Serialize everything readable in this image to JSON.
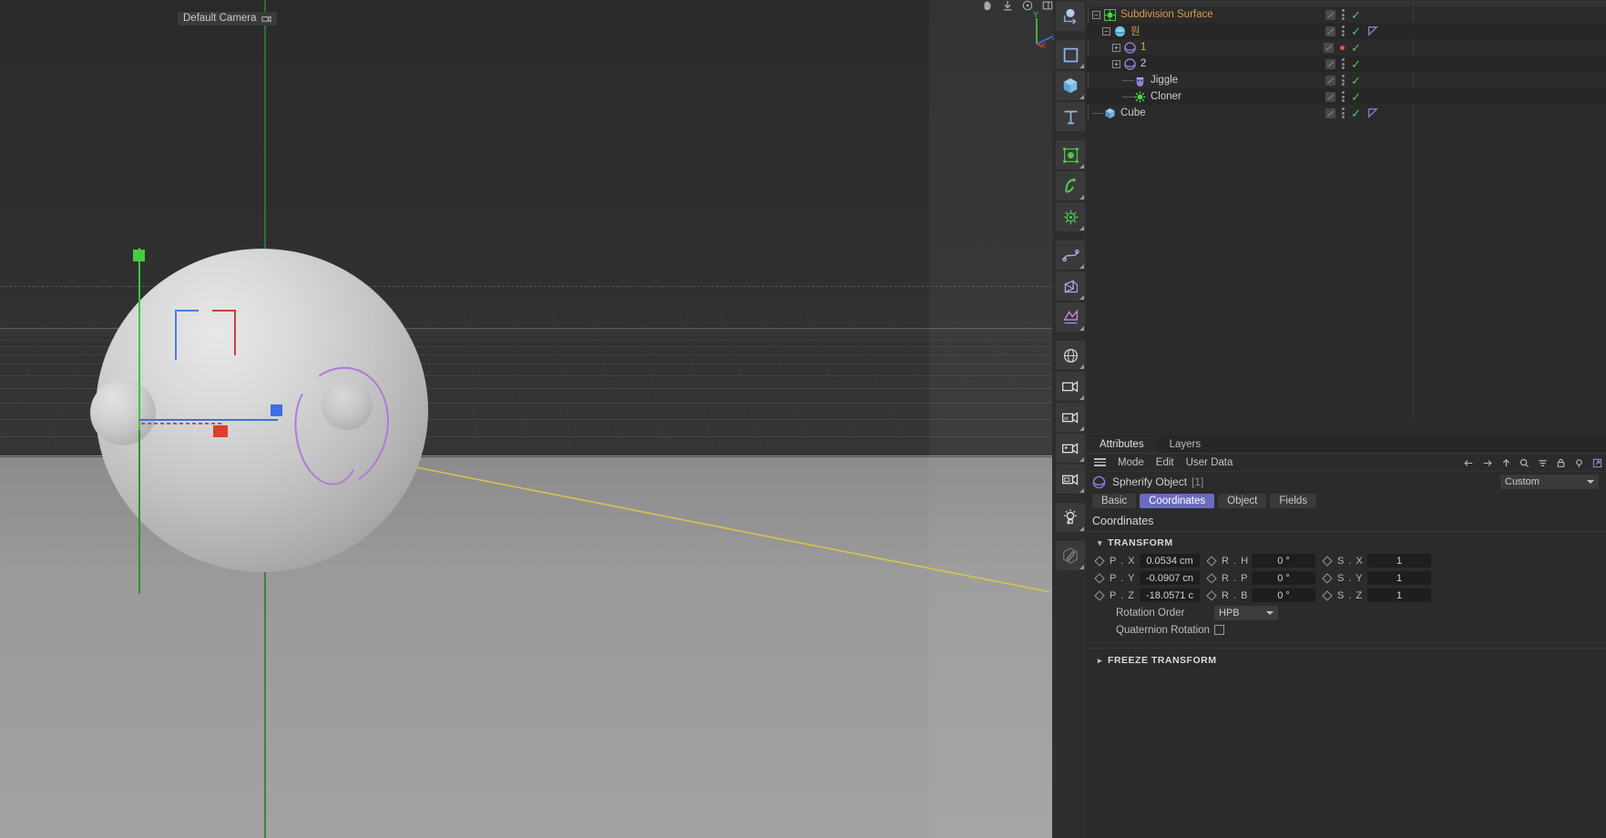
{
  "viewport": {
    "camera_label": "Default Camera",
    "camera_icon": "camera-lock-icon",
    "hud_axes": {
      "y": "Y",
      "x": "X",
      "z": "Z"
    }
  },
  "top_strip": {
    "icons": [
      "hand-icon",
      "move-down-icon",
      "target-icon",
      "frame-icon"
    ]
  },
  "toolbar": {
    "items": [
      {
        "name": "render-preview-icon",
        "glyph": "sphere-arrow"
      },
      {
        "name": "rectangle-select-icon",
        "glyph": "square"
      },
      {
        "name": "cube-primitive-icon",
        "glyph": "cube"
      },
      {
        "name": "text-tool-icon",
        "glyph": "T"
      },
      {
        "name": "spline-pen-icon",
        "glyph": "spline"
      },
      {
        "name": "mograph-icon",
        "glyph": "mograph"
      },
      {
        "name": "deformer-icon",
        "glyph": "deformer"
      },
      {
        "name": "scene-object-icon",
        "glyph": "scene"
      },
      {
        "name": "field-object-icon",
        "glyph": "field"
      },
      {
        "name": "mesh-tool-icon",
        "glyph": "mesh"
      },
      {
        "name": "environment-icon",
        "glyph": "globe"
      },
      {
        "name": "camera-icon",
        "glyph": "camera"
      },
      {
        "name": "stage-camera-icon",
        "glyph": "stage-camera"
      },
      {
        "name": "motion-camera-icon",
        "glyph": "motion-camera"
      },
      {
        "name": "tracker-camera-icon",
        "glyph": "tracker-camera"
      },
      {
        "name": "light-icon",
        "glyph": "light"
      },
      {
        "name": "sketch-material-icon",
        "glyph": "pencil-hex"
      }
    ]
  },
  "object_manager": {
    "rows": [
      {
        "name": "Subdivision Surface",
        "indent": 0,
        "expander": "minus",
        "icon": "subdivision-surface-icon",
        "color": "orange",
        "dot_state": "normal",
        "visible": true,
        "has_flag": false
      },
      {
        "name": "원",
        "indent": 1,
        "expander": "minus",
        "icon": "sphere-icon",
        "color": "orange",
        "dot_state": "normal",
        "visible": true,
        "has_flag": true
      },
      {
        "name": "1",
        "indent": 2,
        "expander": "plus",
        "icon": "spherify-icon",
        "color": "yellow",
        "dot_state": "red",
        "visible": true,
        "has_flag": false
      },
      {
        "name": "2",
        "indent": 2,
        "expander": "plus",
        "icon": "spherify-icon",
        "color": "white",
        "dot_state": "normal",
        "visible": true,
        "has_flag": false
      },
      {
        "name": "Jiggle",
        "indent": 3,
        "expander": "none",
        "icon": "jiggle-icon",
        "color": "white",
        "dot_state": "normal",
        "visible": true,
        "has_flag": false
      },
      {
        "name": "Cloner",
        "indent": 3,
        "expander": "none",
        "icon": "cloner-icon",
        "color": "white",
        "dot_state": "normal",
        "visible": true,
        "has_flag": false
      },
      {
        "name": "Cube",
        "indent": 0,
        "expander": "none",
        "icon": "cube-object-icon",
        "color": "white",
        "dot_state": "normal",
        "visible": true,
        "has_flag": true
      }
    ]
  },
  "attributes": {
    "tabs": [
      {
        "label": "Attributes",
        "active": true
      },
      {
        "label": "Layers",
        "active": false
      }
    ],
    "menu": [
      "Mode",
      "Edit",
      "User Data"
    ],
    "menu_icons": [
      "back-arrow-icon",
      "forward-arrow-icon",
      "up-arrow-icon",
      "search-icon",
      "filter-icon",
      "lock-icon",
      "pin-icon",
      "popout-icon"
    ],
    "object_title": "Spherify Object",
    "object_count": "[1]",
    "custom_select": "Custom",
    "sub_tabs": [
      {
        "label": "Basic",
        "active": false
      },
      {
        "label": "Coordinates",
        "active": true
      },
      {
        "label": "Object",
        "active": false
      },
      {
        "label": "Fields",
        "active": false
      }
    ],
    "section_title": "Coordinates",
    "transform_section": "TRANSFORM",
    "freeze_section": "FREEZE TRANSFORM",
    "transform": {
      "position": [
        {
          "label": "P . X",
          "value": "0.0534 cm"
        },
        {
          "label": "P . Y",
          "value": "-0.0907 cn"
        },
        {
          "label": "P . Z",
          "value": "-18.0571 c"
        }
      ],
      "rotation": [
        {
          "label": "R . H",
          "value": "0 °"
        },
        {
          "label": "R . P",
          "value": "0 °"
        },
        {
          "label": "R . B",
          "value": "0 °"
        }
      ],
      "scale": [
        {
          "label": "S . X",
          "value": "1"
        },
        {
          "label": "S . Y",
          "value": "1"
        },
        {
          "label": "S . Z",
          "value": "1"
        }
      ]
    },
    "rotation_order_label": "Rotation Order",
    "rotation_order_value": "HPB",
    "quaternion_label": "Quaternion Rotation",
    "quaternion_checked": false
  },
  "colors": {
    "accent": "#6b6bbf",
    "orange_text": "#d79b4a",
    "check_green": "#5cc45c",
    "panel_bg": "#2b2b2b",
    "field_bg": "#1e1e1e",
    "axis_x": "#d9402e",
    "axis_y": "#44cc44",
    "axis_z": "#3f6fdf",
    "ray_yellow": "#d8c34a"
  }
}
